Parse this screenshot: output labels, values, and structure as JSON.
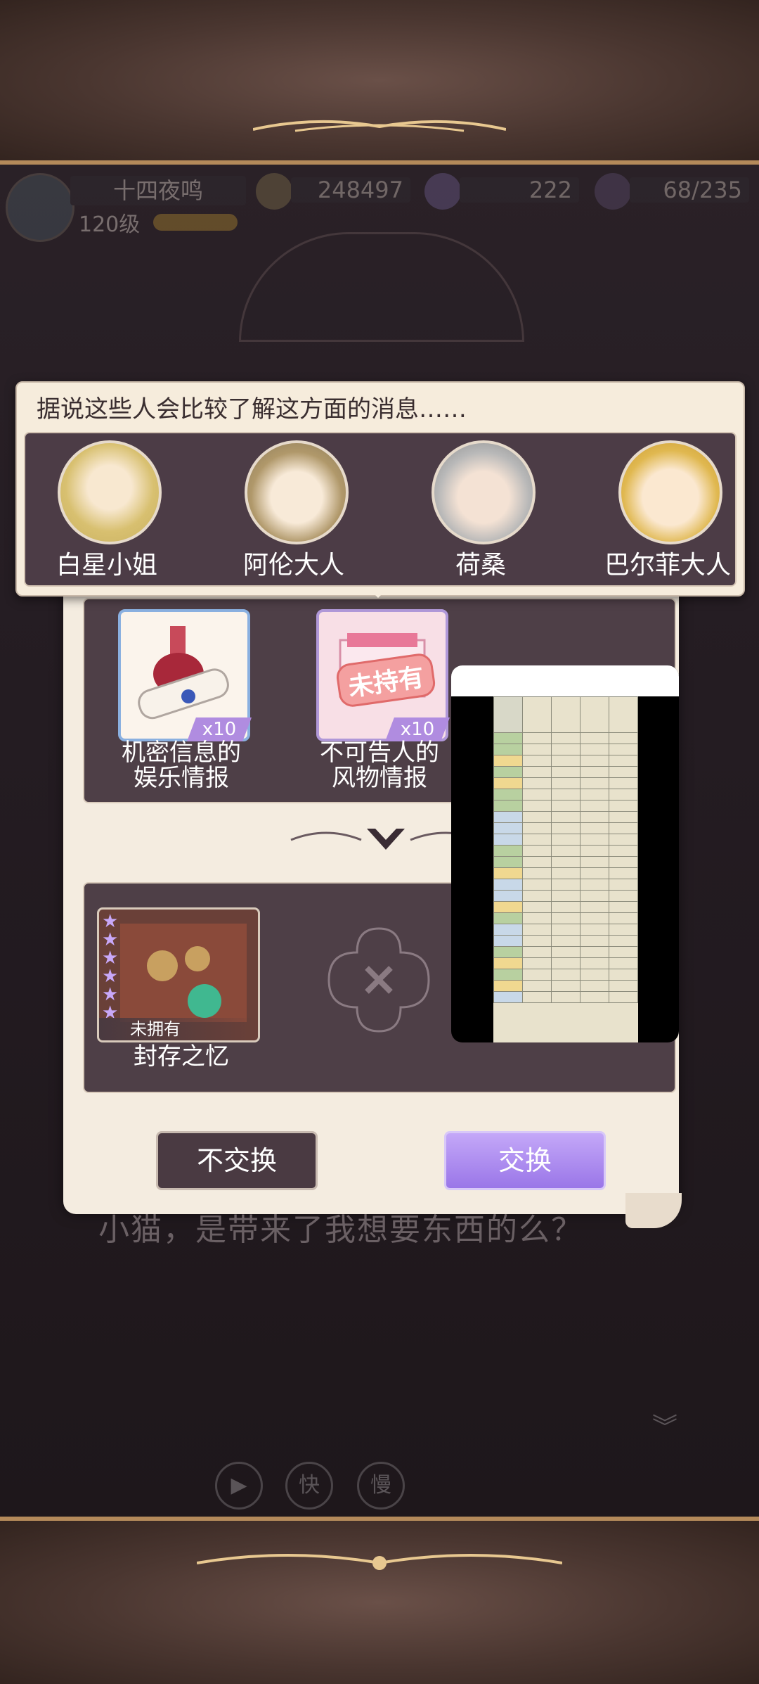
{
  "hud": {
    "player_name": "十四夜鸣",
    "level": "120级",
    "gold": "248497",
    "diamonds": "222",
    "stamina": "68/235"
  },
  "tooltip": {
    "title": "据说这些人会比较了解这方面的消息……",
    "people": [
      {
        "name": "白星小姐"
      },
      {
        "name": "阿伦大人"
      },
      {
        "name": "荷桑"
      },
      {
        "name": "巴尔菲大人"
      }
    ]
  },
  "exchange": {
    "cost_items": [
      {
        "label_line1": "机密信息的",
        "label_line2": "娱乐情报",
        "qty": "x10"
      },
      {
        "label_line1": "不可告人的",
        "label_line2": "风物情报",
        "qty": "x10",
        "stamp": "未持有"
      }
    ],
    "result": {
      "label": "封存之忆",
      "status": "未拥有",
      "stars": 6
    },
    "buttons": {
      "decline": "不交换",
      "accept": "交换"
    }
  },
  "dialogue": {
    "text": "小猫，是带来了我想要东西的么？"
  },
  "controls": {
    "auto": "▶",
    "fast": "快",
    "slow": "慢"
  },
  "colors": {
    "accent_purple": "#a98af0",
    "panel_dark": "#4e3f47",
    "paper": "#f4ece0",
    "gold_trim": "#b48a5a"
  }
}
